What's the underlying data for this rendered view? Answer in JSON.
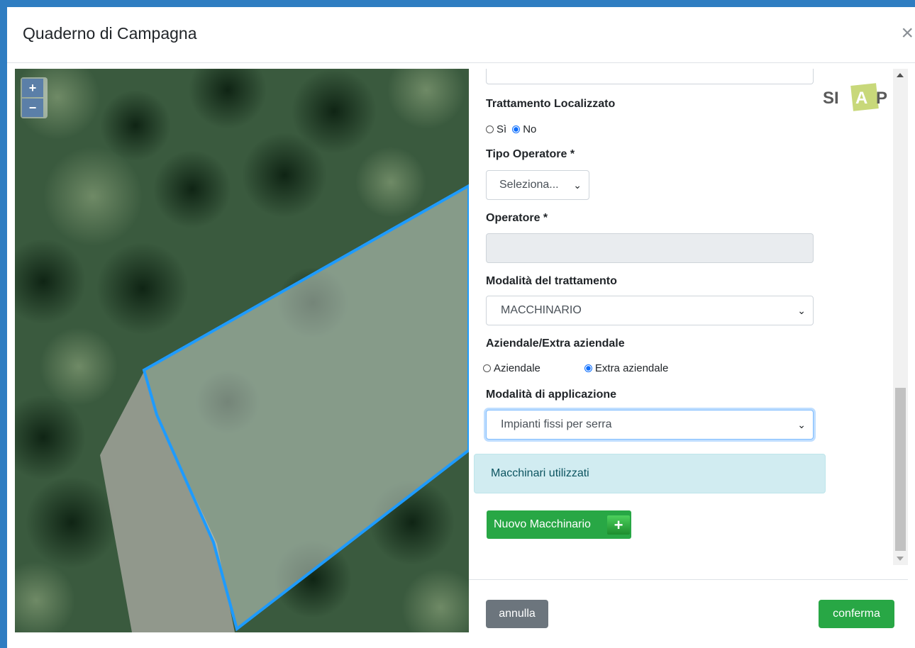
{
  "modal": {
    "title": "Quaderno di Campagna",
    "close_symbol": "×"
  },
  "map": {
    "zoom_in": "+",
    "zoom_out": "−"
  },
  "logo": {
    "si": "SI",
    "a": "A",
    "p": "P"
  },
  "form": {
    "trattamento_localizzato": {
      "label": "Trattamento Localizzato",
      "options": [
        "Sì",
        "No"
      ],
      "selected": "No"
    },
    "tipo_operatore": {
      "label": "Tipo Operatore *",
      "value": "Seleziona..."
    },
    "operatore": {
      "label": "Operatore *",
      "value": ""
    },
    "modalita_trattamento": {
      "label": "Modalità del trattamento",
      "value": "MACCHINARIO"
    },
    "aziendale": {
      "label": "Aziendale/Extra aziendale",
      "options": [
        "Aziendale",
        "Extra aziendale"
      ],
      "selected": "Extra aziendale"
    },
    "modalita_applicazione": {
      "label": "Modalità di applicazione",
      "value": "Impianti fissi per serra"
    },
    "macchinari_alert": "Macchinari utilizzati",
    "nuovo_macchinario": "Nuovo Macchinario",
    "nuovo_macchinario_icon": "+"
  },
  "footer": {
    "cancel": "annulla",
    "confirm": "conferma"
  },
  "colors": {
    "accent_blue": "#2f7dc1",
    "success": "#28a745",
    "secondary": "#6c757d",
    "polygon_outline": "#1e9bff"
  }
}
